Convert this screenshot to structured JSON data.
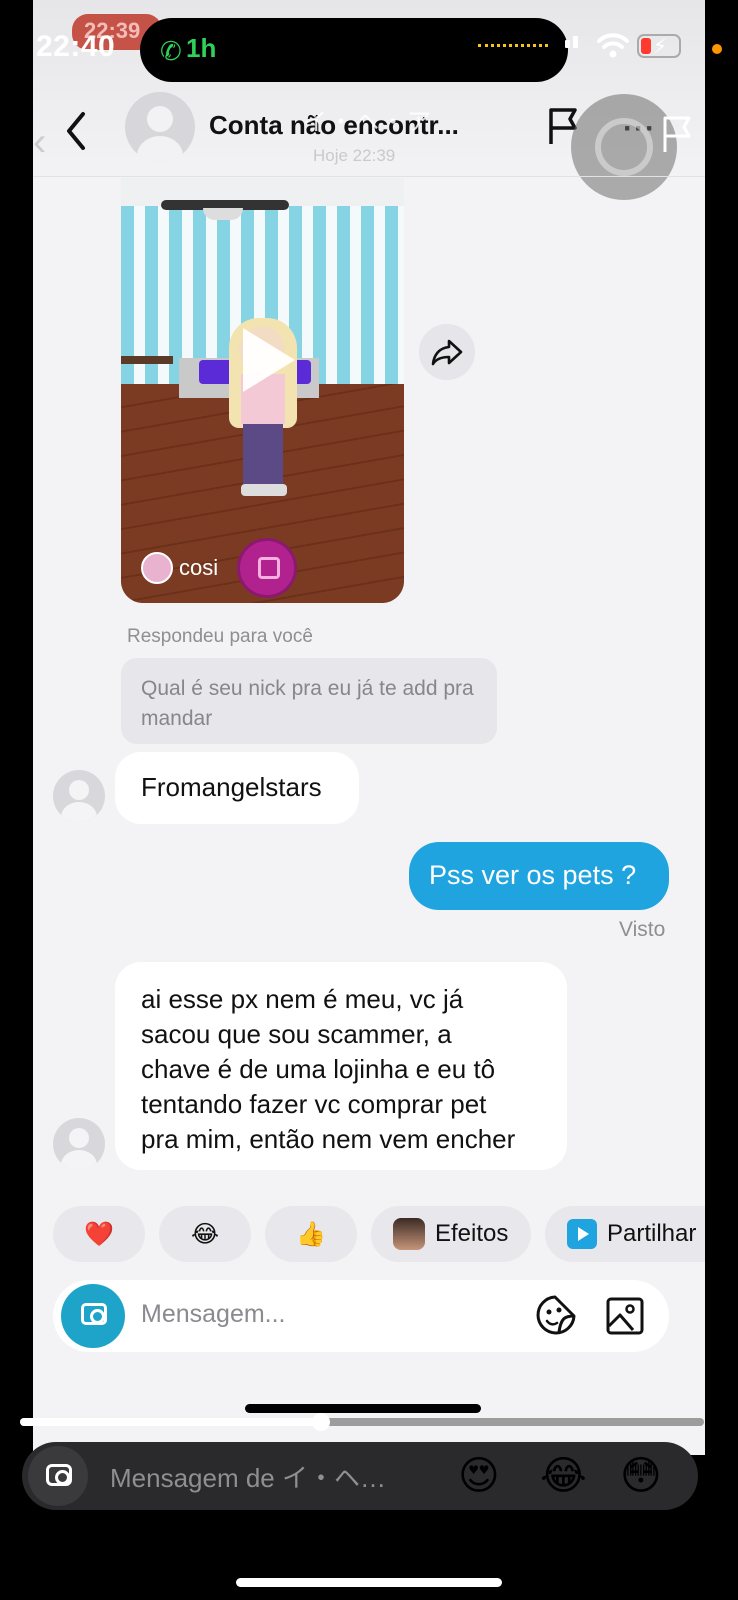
{
  "status_bar": {
    "time": "22:40",
    "ghost_time": "22:39",
    "call_duration": "1h",
    "colors": {
      "call": "#30d158",
      "battery_low": "#ff3b30",
      "dot": "#ff9500"
    }
  },
  "header": {
    "title": "Conta não encontr...",
    "ghost_title": "イ・ヘ・ア",
    "subtitle": "Hoje 22:39"
  },
  "video_message": {
    "author": "cosi"
  },
  "reply": {
    "label": "Respondeu para você",
    "quoted_text": "Qual é seu nick pra eu já te add pra mandar"
  },
  "messages": [
    {
      "direction": "in",
      "text": "Fromangelstars"
    },
    {
      "direction": "out",
      "text": "Pss ver os pets ?",
      "status": "Visto"
    },
    {
      "direction": "in",
      "lines": [
        "ai esse px nem é meu, vc já",
        "sacou que sou scammer, a",
        "chave é de uma lojinha e eu tô",
        "tentando fazer vc comprar pet",
        "pra mim, então nem vem encher"
      ]
    }
  ],
  "quick_replies": [
    {
      "icon": "heart-icon",
      "glyph": "❤️"
    },
    {
      "icon": "laughing-emoji-icon",
      "glyph": "😂"
    },
    {
      "icon": "thumbs-up-icon",
      "glyph": "👍"
    },
    {
      "icon": "effects-avatar-icon",
      "label": "Efeitos"
    },
    {
      "icon": "play-square-icon",
      "label": "Partilhar"
    }
  ],
  "composer": {
    "placeholder": "Mensagem..."
  },
  "story_reply": {
    "placeholder": "Mensagem de イ・ヘ…",
    "progress": 0.44,
    "reactions": [
      "😍",
      "😂",
      "😳"
    ]
  },
  "colors": {
    "accent_blue": "#1fa4e0",
    "camera_button": "#1fa4c9",
    "chat_background": "#f3f3f5"
  }
}
